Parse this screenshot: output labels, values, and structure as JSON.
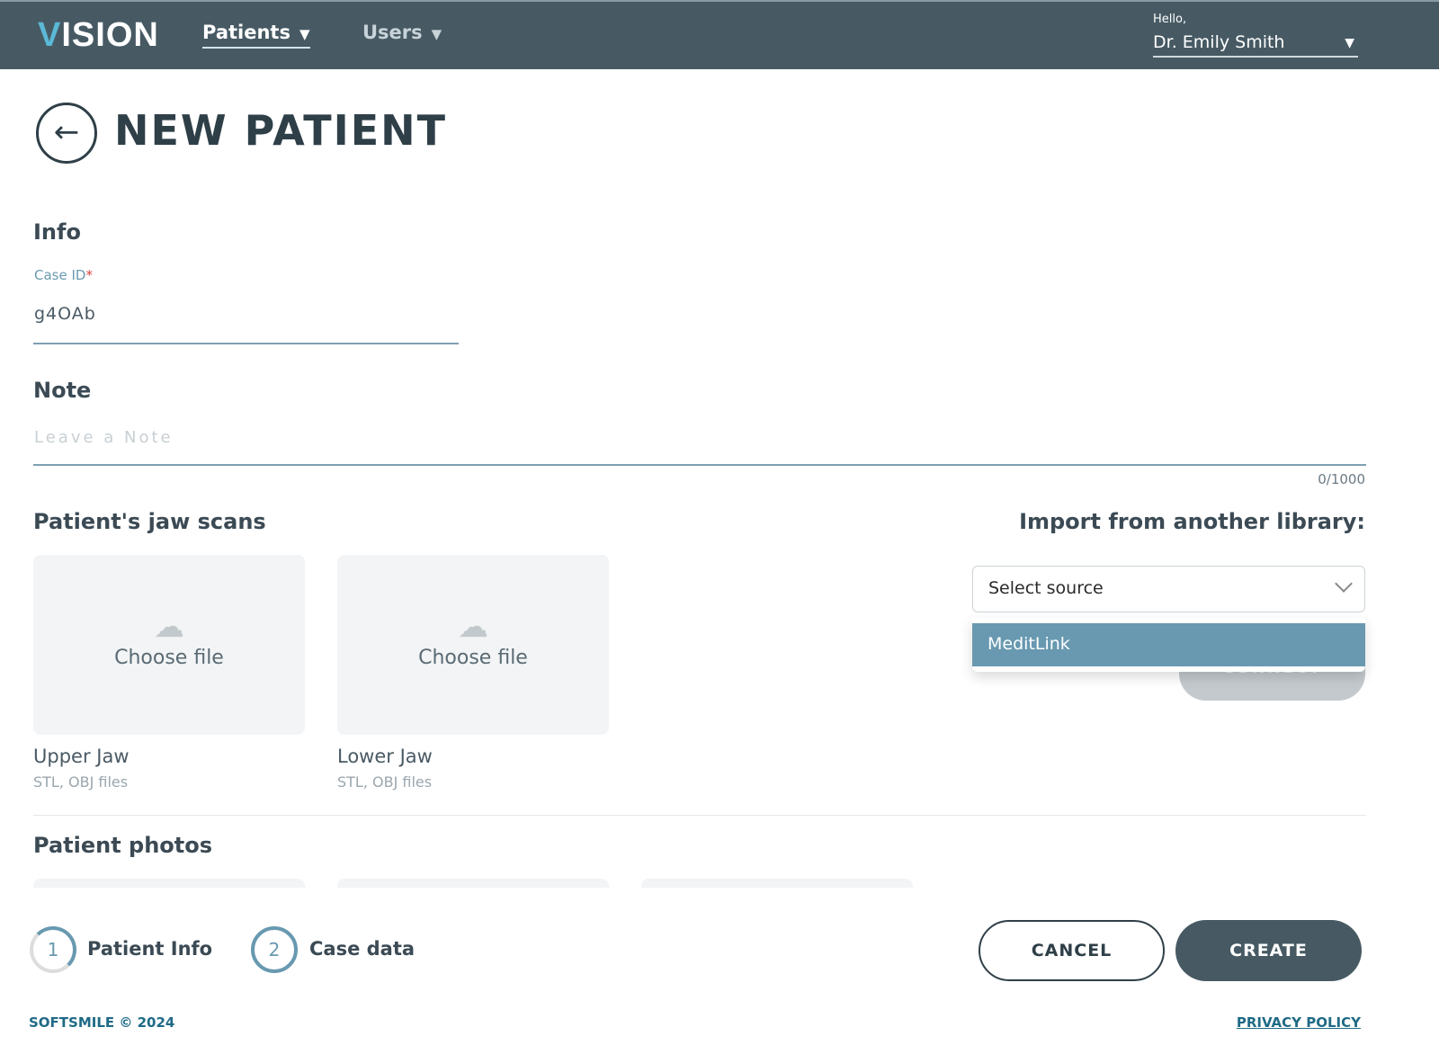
{
  "header": {
    "logo_accent": "V",
    "logo_rest": "ISION",
    "nav": [
      {
        "label": "Patients",
        "active": true
      },
      {
        "label": "Users",
        "active": false
      }
    ],
    "greeting": "Hello,",
    "user_name": "Dr. Emily Smith",
    "dropdown_glyph": "▼"
  },
  "page": {
    "title": "NEW PATIENT",
    "back_icon": "←"
  },
  "info": {
    "heading": "Info",
    "case_id_label": "Case ID",
    "required_mark": "*",
    "case_id_value": "g4OAb"
  },
  "note": {
    "heading": "Note",
    "placeholder": "Leave a Note",
    "counter": "0/1000"
  },
  "scans": {
    "heading": "Patient's jaw scans",
    "items": [
      {
        "action": "Choose file",
        "name": "Upper Jaw",
        "types": "STL, OBJ files"
      },
      {
        "action": "Choose file",
        "name": "Lower Jaw",
        "types": "STL, OBJ files"
      }
    ]
  },
  "import": {
    "heading": "Import from another library:",
    "select_placeholder": "Select source",
    "options": [
      "MeditLink"
    ],
    "connect_label": "CONNECT"
  },
  "photos": {
    "heading": "Patient photos"
  },
  "steps": [
    {
      "number": "1",
      "label": "Patient Info"
    },
    {
      "number": "2",
      "label": "Case data"
    }
  ],
  "actions": {
    "cancel": "CANCEL",
    "create": "CREATE"
  },
  "footer": {
    "copyright": "SOFTSMILE © 2024",
    "privacy": "PRIVACY POLICY"
  },
  "colors": {
    "header": "#475a64",
    "accent": "#6899b0",
    "link": "#1f6a86"
  }
}
